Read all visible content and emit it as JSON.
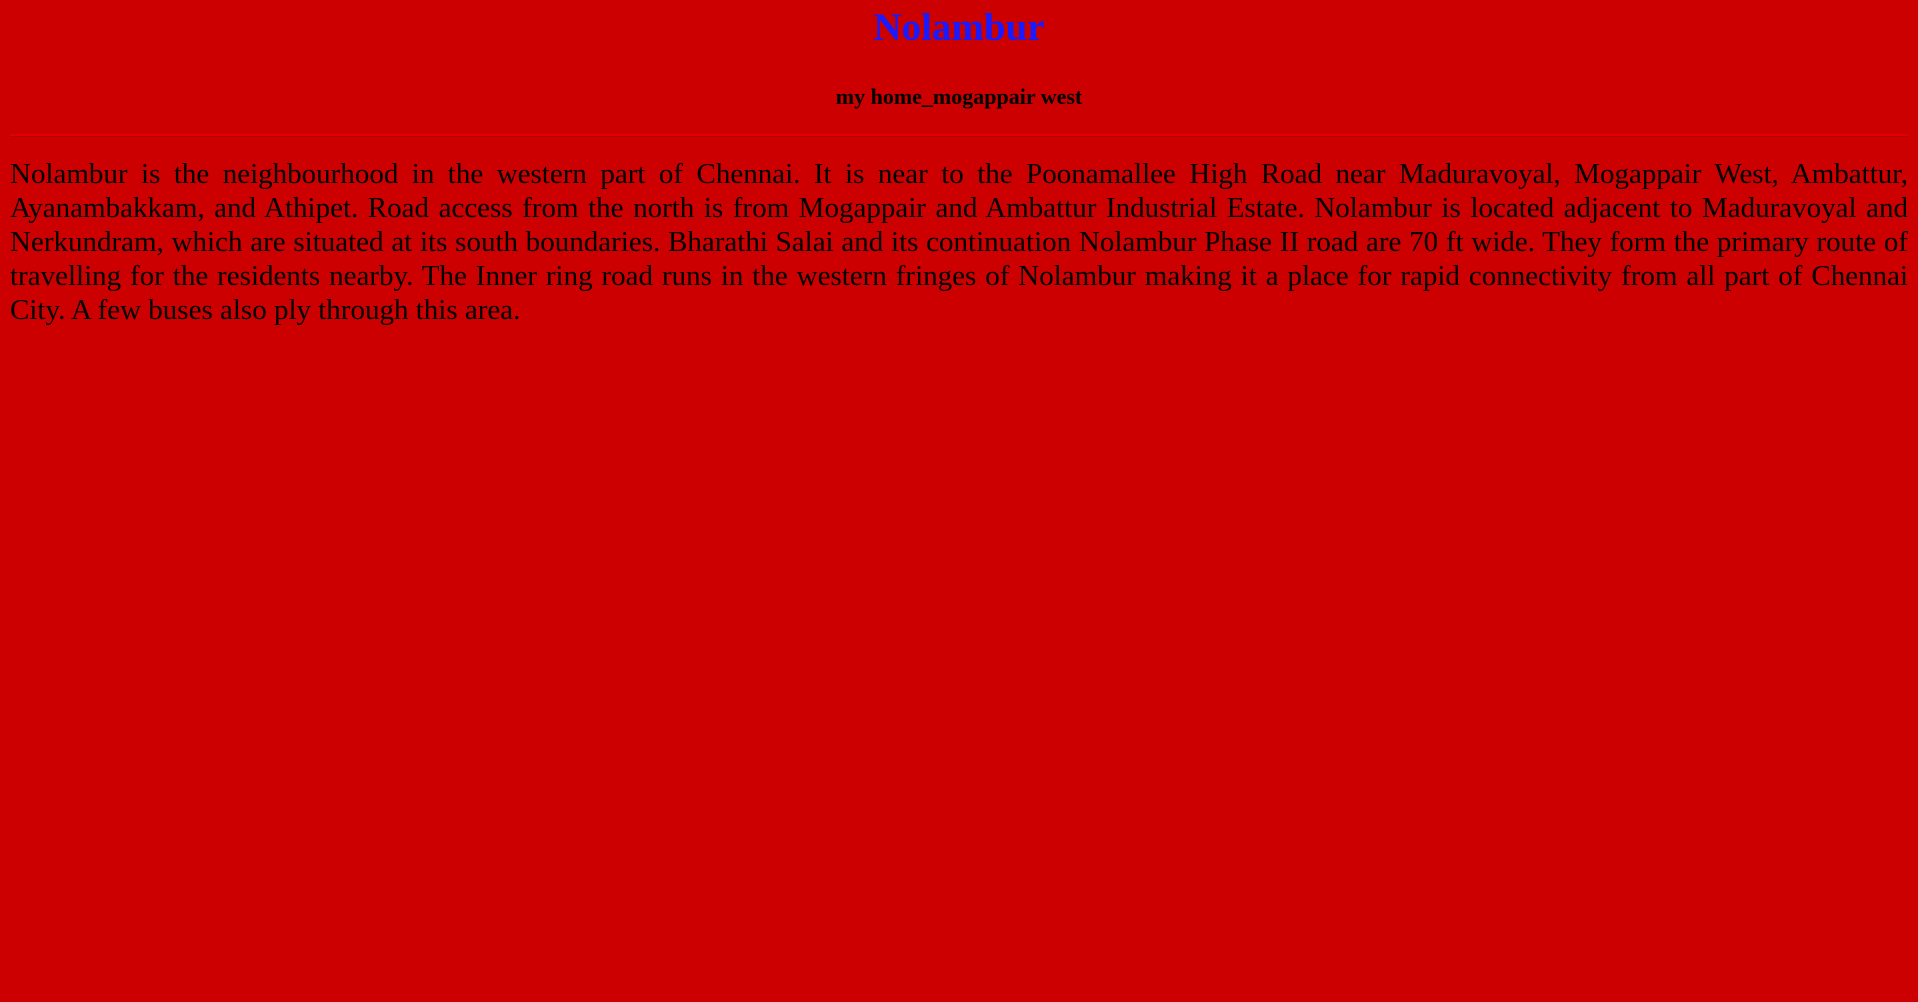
{
  "page": {
    "title": "Nolambur",
    "subtitle": "my home_mogappair west",
    "paragraph": "Nolambur is the neighbourhood in the western part of Chennai. It is near to the Poonamallee High Road near Maduravoyal, Mogappair West, Ambattur, Ayanambakkam, and Athipet. Road access from the north is from Mogappair and Ambattur Industrial Estate. Nolambur is located adjacent to Maduravoyal and Nerkundram, which are situated at its south boundaries. Bharathi Salai and its continuation Nolambur Phase II road are 70 ft wide. They form the primary route of travelling for the residents nearby. The Inner ring road runs in the western fringes of Nolambur making it a place for rapid connectivity from all part of Chennai City. A few buses also ply through this area."
  },
  "colors": {
    "background": "#cc0000",
    "title": "#1a1aff",
    "text": "#000000",
    "divider": "#e00000"
  }
}
